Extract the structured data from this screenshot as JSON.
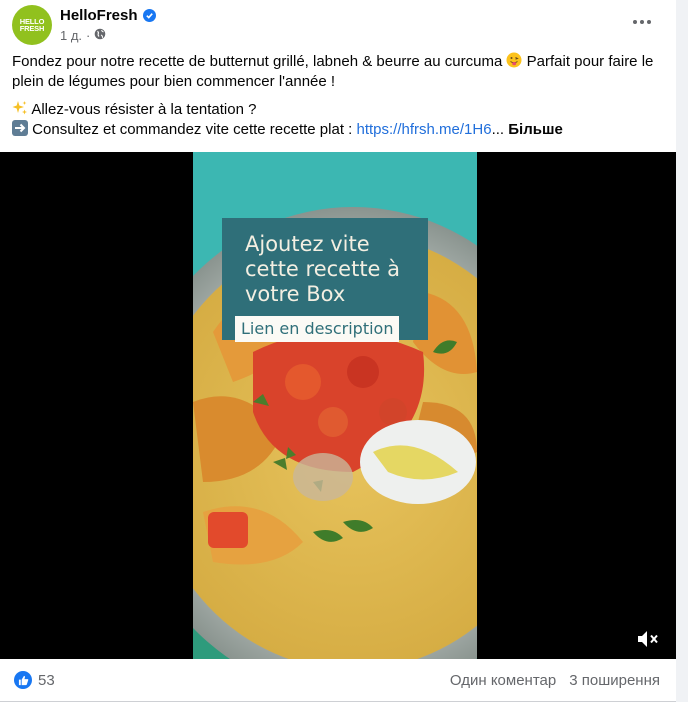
{
  "post": {
    "author": "HelloFresh",
    "avatar_text_line1": "HELLO",
    "avatar_text_line2": "FRESH",
    "time": "1 д.",
    "separator": "·",
    "caption_line1": "Fondez pour notre recette de butternut grillé, labneh & beurre au curcuma",
    "caption_line1_end": "Parfait pour faire le plein de légumes pour bien commencer l'année !",
    "caption_line2": "Allez-vous résister à la tentation ?",
    "caption_line3": "Consultez et commandez vite cette recette plat :",
    "link": "https://hfrsh.me/1H6",
    "ellipsis": "...",
    "see_more": "Більше"
  },
  "video": {
    "overlay_title": "Ajoutez vite cette recette à votre Box",
    "overlay_button": "Lien en description"
  },
  "footer": {
    "likes_count": "53",
    "comments": "Один коментар",
    "shares": "3 поширення"
  },
  "colors": {
    "brand_green": "#91c11e",
    "link_blue": "#216fdb",
    "facebook_blue": "#1877f2",
    "overlay_teal": "#2f6f79"
  },
  "icons": [
    "verified-badge-icon",
    "globe-icon",
    "more-options-icon",
    "sparkles-icon",
    "right-arrow-icon",
    "tongue-emoji-icon",
    "mute-icon",
    "like-icon"
  ]
}
